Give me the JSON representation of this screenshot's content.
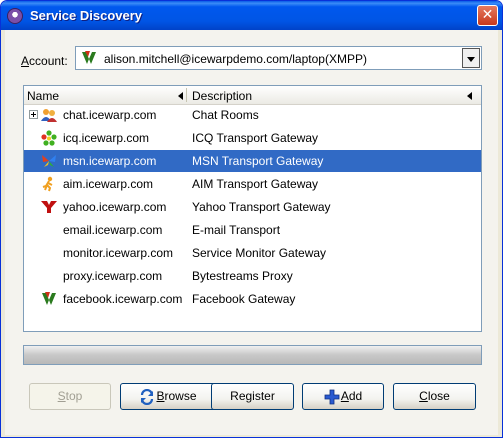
{
  "window": {
    "title": "Service Discovery",
    "close_glyph": "✕"
  },
  "account": {
    "label_first": "A",
    "label_rest": "ccount:",
    "value": "alison.mitchell@icewarpdemo.com/laptop(XMPP)"
  },
  "list": {
    "columns": {
      "name": "Name",
      "description": "Description"
    },
    "rows": [
      {
        "name": "chat.icewarp.com",
        "description": "Chat Rooms",
        "icon": "chat-rooms-icon"
      },
      {
        "name": "icq.icewarp.com",
        "description": "ICQ Transport Gateway",
        "icon": "icq-flower-icon"
      },
      {
        "name": "msn.icewarp.com",
        "description": "MSN Transport Gateway",
        "icon": "msn-butterfly-icon",
        "selected": true
      },
      {
        "name": "aim.icewarp.com",
        "description": "AIM Transport Gateway",
        "icon": "aim-runner-icon"
      },
      {
        "name": "yahoo.icewarp.com",
        "description": "Yahoo Transport Gateway",
        "icon": "yahoo-y-icon"
      },
      {
        "name": "email.icewarp.com",
        "description": "E-mail Transport",
        "icon": ""
      },
      {
        "name": "monitor.icewarp.com",
        "description": "Service Monitor Gateway",
        "icon": ""
      },
      {
        "name": "proxy.icewarp.com",
        "description": "Bytestreams Proxy",
        "icon": ""
      },
      {
        "name": "facebook.icewarp.com",
        "description": "Facebook Gateway",
        "icon": "facebook-v-icon"
      }
    ]
  },
  "buttons": {
    "stop_first": "S",
    "stop_rest": "top",
    "browse_first": "B",
    "browse_rest": "rowse",
    "register": "Register",
    "add_first": "A",
    "add_rest": "dd",
    "close_first": "C",
    "close_rest": "lose"
  },
  "colors": {
    "selection": "#316ac5",
    "title_bar": "#0055e5",
    "button_border": "#003c74"
  }
}
